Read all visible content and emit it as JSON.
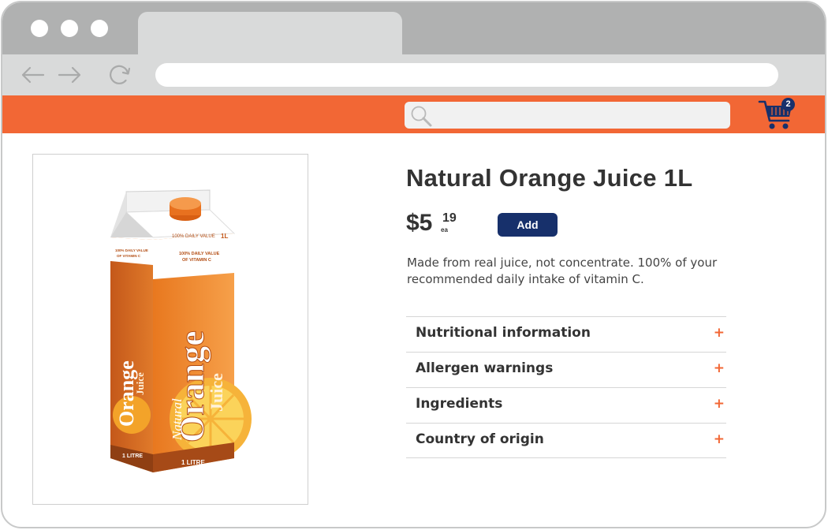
{
  "browser": {
    "window_dots": [
      "close",
      "minimize",
      "maximize"
    ],
    "nav_icons": [
      "back-arrow-icon",
      "forward-arrow-icon",
      "reload-icon"
    ],
    "address_value": ""
  },
  "store_header": {
    "search_placeholder": "",
    "search_icon": "search-icon",
    "cart_icon": "cart-icon",
    "cart_count": "2",
    "brand_color": "#f26735",
    "accent_color": "#17306b"
  },
  "product": {
    "title": "Natural Orange Juice 1L",
    "price_dollars": "$5",
    "price_cents": "19",
    "price_unit": "ea",
    "add_label": "Add",
    "description": "Made from real juice, not concentrate. 100% of your recommended daily intake of vitamin C.",
    "image": {
      "natural": "Natural",
      "orange": "Orange",
      "juice": "Juice",
      "size": "1L",
      "litre_front": "1 LITRE",
      "litre_side": "1 LITRE",
      "daily_value": "100% DAILY VALUE",
      "vitamin_c": "OF VITAMIN C",
      "side_daily": "100% DAILY VALUE",
      "side_vitamin": "OF VITAMIN C"
    }
  },
  "accordion": [
    {
      "label": "Nutritional information",
      "icon": "+"
    },
    {
      "label": "Allergen warnings",
      "icon": "+"
    },
    {
      "label": "Ingredients",
      "icon": "+"
    },
    {
      "label": "Country of origin",
      "icon": "+"
    }
  ]
}
